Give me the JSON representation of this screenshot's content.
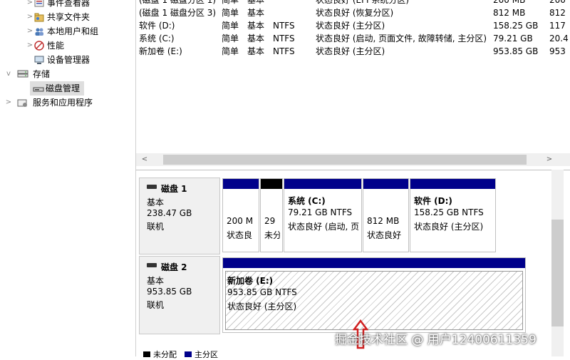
{
  "tree": {
    "items": [
      {
        "label": "事件查看器",
        "icon": "event-viewer-icon",
        "indent": 2
      },
      {
        "label": "共享文件夹",
        "icon": "shared-folder-icon",
        "indent": 2
      },
      {
        "label": "本地用户和组",
        "icon": "users-icon",
        "indent": 2
      },
      {
        "label": "性能",
        "icon": "performance-icon",
        "indent": 2
      },
      {
        "label": "设备管理器",
        "icon": "device-manager-icon",
        "indent": 1
      },
      {
        "label": "存储",
        "icon": "storage-icon",
        "indent": 0
      },
      {
        "label": "磁盘管理",
        "icon": "disk-management-icon",
        "indent": 1
      },
      {
        "label": "服务和应用程序",
        "icon": "services-icon",
        "indent": 0
      }
    ]
  },
  "volumes": [
    {
      "name": "(磁盘 1 磁盘分区 1)",
      "layout": "简单",
      "type": "基本",
      "fs": "",
      "status": "状态良好 (EFI 系统分区)",
      "capacity": "200 MB",
      "free": "200"
    },
    {
      "name": "(磁盘 1 磁盘分区 3)",
      "layout": "简单",
      "type": "基本",
      "fs": "",
      "status": "状态良好 (恢复分区)",
      "capacity": "812 MB",
      "free": "812"
    },
    {
      "name": "软件 (D:)",
      "layout": "简单",
      "type": "基本",
      "fs": "NTFS",
      "status": "状态良好 (主分区)",
      "capacity": "158.25 GB",
      "free": "117"
    },
    {
      "name": "系统 (C:)",
      "layout": "简单",
      "type": "基本",
      "fs": "NTFS",
      "status": "状态良好 (启动, 页面文件, 故障转储, 主分区)",
      "capacity": "79.21 GB",
      "free": "20.4"
    },
    {
      "name": "新加卷 (E:)",
      "layout": "简单",
      "type": "基本",
      "fs": "NTFS",
      "status": "状态良好 (主分区)",
      "capacity": "953.85 GB",
      "free": "953"
    }
  ],
  "disks": [
    {
      "name": "磁盘 1",
      "type": "基本",
      "size": "238.47 GB",
      "state": "联机",
      "partitions": [
        {
          "title": "",
          "line1": "200 M",
          "line2": "状态良",
          "bar": "#00008b"
        },
        {
          "title": "",
          "line1": "29",
          "line2": "未分",
          "bar": "#000000"
        },
        {
          "title": "系统  (C:)",
          "line1": "79.21 GB NTFS",
          "line2": "状态良好 (启动, 页",
          "bar": "#00008b"
        },
        {
          "title": "",
          "line1": "812 MB",
          "line2": "状态良好",
          "bar": "#00008b"
        },
        {
          "title": "软件  (D:)",
          "line1": "158.25 GB NTFS",
          "line2": "状态良好 (主分区)",
          "bar": "#00008b"
        }
      ]
    },
    {
      "name": "磁盘 2",
      "type": "基本",
      "size": "953.85 GB",
      "state": "联机",
      "partitions": [
        {
          "title": "新加卷  (E:)",
          "line1": "953.85 GB NTFS",
          "line2": "状态良好 (主分区)",
          "bar": "#00008b"
        }
      ]
    }
  ],
  "legend": {
    "unallocated": "未分配",
    "primary": "主分区"
  },
  "watermark": "掘金技术社区 @ 用户12400611359",
  "colors": {
    "primary_bar": "#00008b",
    "unallocated_bar": "#000000",
    "selection": "#dedede"
  }
}
